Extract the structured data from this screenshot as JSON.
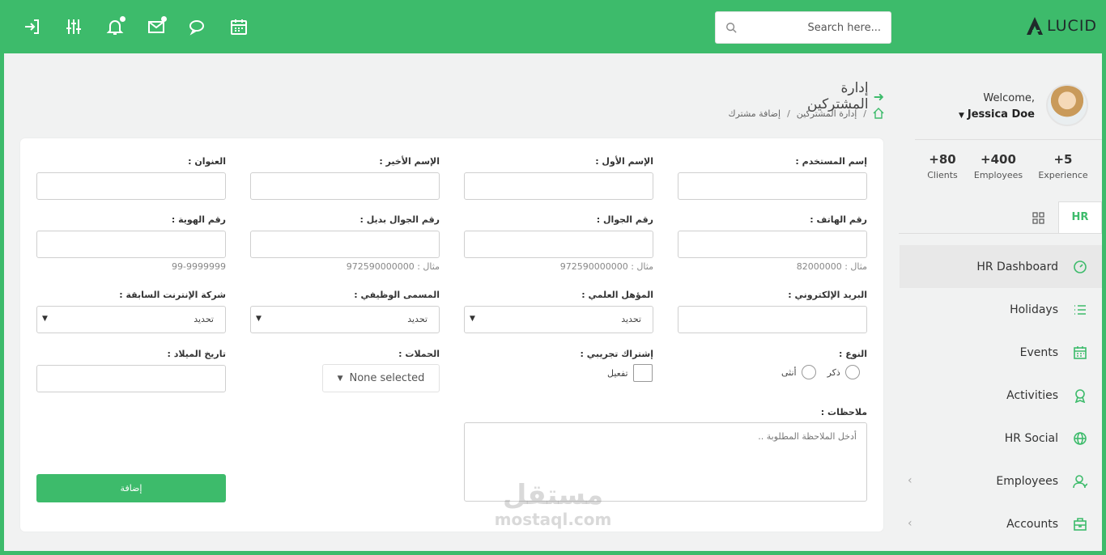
{
  "topbar": {
    "icons": [
      "logout-icon",
      "sliders-icon",
      "bell-icon",
      "mail-icon",
      "chat-icon",
      "calendar-icon"
    ],
    "search_placeholder": "Search here...",
    "logo_text": "LUCID"
  },
  "sidebar": {
    "welcome": "Welcome,",
    "user_name": "Jessica Doe",
    "stats": [
      {
        "value": "+80",
        "label": "Clients"
      },
      {
        "value": "+400",
        "label": "Employees"
      },
      {
        "value": "+5",
        "label": "Experience"
      }
    ],
    "tab_hr": "HR",
    "menu": [
      {
        "label": "HR Dashboard",
        "icon": "speedometer-icon",
        "active": true
      },
      {
        "label": "Holidays",
        "icon": "list-icon"
      },
      {
        "label": "Events",
        "icon": "calendar-icon"
      },
      {
        "label": "Activities",
        "icon": "award-icon"
      },
      {
        "label": "HR Social",
        "icon": "globe-icon"
      },
      {
        "label": "Employees",
        "icon": "users-icon",
        "expandable": true
      },
      {
        "label": "Accounts",
        "icon": "briefcase-icon",
        "expandable": true
      }
    ]
  },
  "header": {
    "title": "إدارة المشتركين",
    "breadcrumb": [
      "إدارة المشتركين",
      "إضافة مشترك"
    ]
  },
  "form": {
    "username_label": "إسم المستخدم :",
    "firstname_label": "الإسم الأول :",
    "lastname_label": "الإسم الأخير :",
    "address_label": "العنوان :",
    "phone_label": "رقم الهاتف :",
    "phone_hint": "مثال : 82000000",
    "mobile_label": "رقم الجوال :",
    "mobile_hint": "مثال : 972590000000",
    "alt_mobile_label": "رقم الجوال بديل :",
    "alt_mobile_hint": "مثال : 972590000000",
    "id_label": "رقم الهوية :",
    "id_hint": "99-9999999",
    "email_label": "البريد الإلكتروني :",
    "qualification_label": "المؤهل العلمي :",
    "job_title_label": "المسمى الوظيفي :",
    "isp_label": "شركة الإنترنت السابقة :",
    "select_placeholder": "تحديد",
    "gender_label": "النوع :",
    "gender_male": "ذكر",
    "gender_female": "أنثى",
    "trial_label": "إشتراك تجريبي :",
    "trial_option": "تفعيل",
    "campaigns_label": "الحملات :",
    "campaigns_value": "None selected",
    "birthdate_label": "تاريخ الميلاد :",
    "notes_label": "ملاحظات :",
    "notes_placeholder": "أدخل الملاحظة المطلوبة ..",
    "submit_label": "إضافة"
  },
  "watermark": {
    "arabic": "مستقل",
    "latin": "mostaql.com"
  },
  "colors": {
    "brand_green": "#3dbb6b",
    "background": "#f1f2f2"
  }
}
